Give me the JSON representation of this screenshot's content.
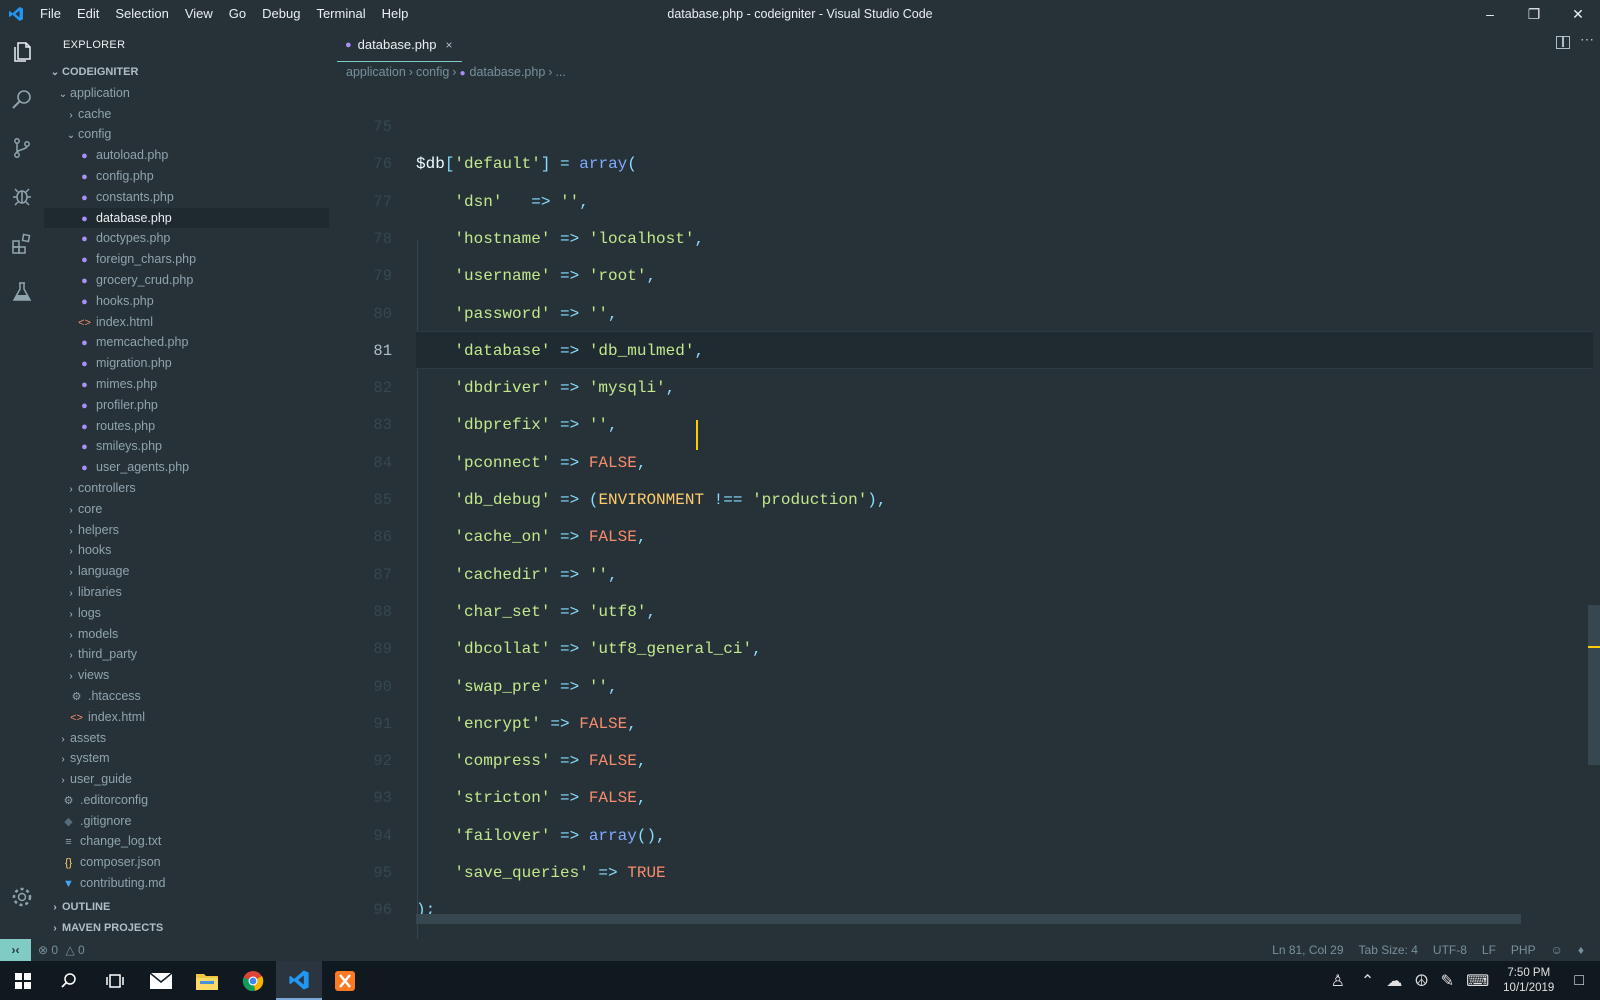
{
  "window": {
    "title": "database.php - codeigniter - Visual Studio Code",
    "menu": [
      "File",
      "Edit",
      "Selection",
      "View",
      "Go",
      "Debug",
      "Terminal",
      "Help"
    ]
  },
  "explorer": {
    "title": "EXPLORER",
    "project": "CODEIGNITER",
    "outline": "OUTLINE",
    "maven": "MAVEN PROJECTS",
    "items": [
      {
        "label": "application",
        "depth": 1,
        "chevron": "v",
        "icon": ""
      },
      {
        "label": "cache",
        "depth": 2,
        "chevron": ">",
        "icon": ""
      },
      {
        "label": "config",
        "depth": 2,
        "chevron": "v",
        "icon": ""
      },
      {
        "label": "autoload.php",
        "depth": 3,
        "chevron": "",
        "icon": "php"
      },
      {
        "label": "config.php",
        "depth": 3,
        "chevron": "",
        "icon": "php"
      },
      {
        "label": "constants.php",
        "depth": 3,
        "chevron": "",
        "icon": "php"
      },
      {
        "label": "database.php",
        "depth": 3,
        "chevron": "",
        "icon": "php",
        "selected": true
      },
      {
        "label": "doctypes.php",
        "depth": 3,
        "chevron": "",
        "icon": "php"
      },
      {
        "label": "foreign_chars.php",
        "depth": 3,
        "chevron": "",
        "icon": "php"
      },
      {
        "label": "grocery_crud.php",
        "depth": 3,
        "chevron": "",
        "icon": "php"
      },
      {
        "label": "hooks.php",
        "depth": 3,
        "chevron": "",
        "icon": "php"
      },
      {
        "label": "index.html",
        "depth": 3,
        "chevron": "",
        "icon": "html"
      },
      {
        "label": "memcached.php",
        "depth": 3,
        "chevron": "",
        "icon": "php"
      },
      {
        "label": "migration.php",
        "depth": 3,
        "chevron": "",
        "icon": "php"
      },
      {
        "label": "mimes.php",
        "depth": 3,
        "chevron": "",
        "icon": "php"
      },
      {
        "label": "profiler.php",
        "depth": 3,
        "chevron": "",
        "icon": "php"
      },
      {
        "label": "routes.php",
        "depth": 3,
        "chevron": "",
        "icon": "php"
      },
      {
        "label": "smileys.php",
        "depth": 3,
        "chevron": "",
        "icon": "php"
      },
      {
        "label": "user_agents.php",
        "depth": 3,
        "chevron": "",
        "icon": "php"
      },
      {
        "label": "controllers",
        "depth": 2,
        "chevron": ">",
        "icon": ""
      },
      {
        "label": "core",
        "depth": 2,
        "chevron": ">",
        "icon": ""
      },
      {
        "label": "helpers",
        "depth": 2,
        "chevron": ">",
        "icon": ""
      },
      {
        "label": "hooks",
        "depth": 2,
        "chevron": ">",
        "icon": ""
      },
      {
        "label": "language",
        "depth": 2,
        "chevron": ">",
        "icon": ""
      },
      {
        "label": "libraries",
        "depth": 2,
        "chevron": ">",
        "icon": ""
      },
      {
        "label": "logs",
        "depth": 2,
        "chevron": ">",
        "icon": ""
      },
      {
        "label": "models",
        "depth": 2,
        "chevron": ">",
        "icon": ""
      },
      {
        "label": "third_party",
        "depth": 2,
        "chevron": ">",
        "icon": ""
      },
      {
        "label": "views",
        "depth": 2,
        "chevron": ">",
        "icon": ""
      },
      {
        "label": ".htaccess",
        "depth": 2,
        "chevron": "",
        "icon": "gear"
      },
      {
        "label": "index.html",
        "depth": 2,
        "chevron": "",
        "icon": "html"
      },
      {
        "label": "assets",
        "depth": 1,
        "chevron": ">",
        "icon": ""
      },
      {
        "label": "system",
        "depth": 1,
        "chevron": ">",
        "icon": ""
      },
      {
        "label": "user_guide",
        "depth": 1,
        "chevron": ">",
        "icon": ""
      },
      {
        "label": ".editorconfig",
        "depth": 1,
        "chevron": "",
        "icon": "gear"
      },
      {
        "label": ".gitignore",
        "depth": 1,
        "chevron": "",
        "icon": "git"
      },
      {
        "label": "change_log.txt",
        "depth": 1,
        "chevron": "",
        "icon": "txt"
      },
      {
        "label": "composer.json",
        "depth": 1,
        "chevron": "",
        "icon": "json"
      },
      {
        "label": "contributing.md",
        "depth": 1,
        "chevron": "",
        "icon": "md"
      }
    ]
  },
  "tab": {
    "label": "database.php",
    "close": "×"
  },
  "breadcrumb": [
    "application",
    "config",
    "database.php",
    "..."
  ],
  "code": {
    "current_line": 81,
    "lines": [
      {
        "n": "75",
        "tokens": []
      },
      {
        "n": "76",
        "tokens": [
          [
            "v",
            "$db"
          ],
          [
            "p",
            "["
          ],
          [
            "s",
            "'default'"
          ],
          [
            "p",
            "]"
          ],
          [
            "o",
            " = "
          ],
          [
            "f",
            "array"
          ],
          [
            "p",
            "("
          ]
        ]
      },
      {
        "n": "77",
        "tokens": [
          [
            "s",
            "    'dsn'"
          ],
          [
            "o",
            "   => "
          ],
          [
            "s",
            "''"
          ],
          [
            "p",
            ","
          ]
        ]
      },
      {
        "n": "78",
        "tokens": [
          [
            "s",
            "    'hostname'"
          ],
          [
            "o",
            " => "
          ],
          [
            "s",
            "'localhost'"
          ],
          [
            "p",
            ","
          ]
        ]
      },
      {
        "n": "79",
        "tokens": [
          [
            "s",
            "    'username'"
          ],
          [
            "o",
            " => "
          ],
          [
            "s",
            "'root'"
          ],
          [
            "p",
            ","
          ]
        ]
      },
      {
        "n": "80",
        "tokens": [
          [
            "s",
            "    'password'"
          ],
          [
            "o",
            " => "
          ],
          [
            "s",
            "''"
          ],
          [
            "p",
            ","
          ]
        ]
      },
      {
        "n": "81",
        "tokens": [
          [
            "s",
            "    'database'"
          ],
          [
            "o",
            " => "
          ],
          [
            "s",
            "'db_mulmed'"
          ],
          [
            "p",
            ","
          ]
        ]
      },
      {
        "n": "82",
        "tokens": [
          [
            "s",
            "    'dbdriver'"
          ],
          [
            "o",
            " => "
          ],
          [
            "s",
            "'mysqli'"
          ],
          [
            "p",
            ","
          ]
        ]
      },
      {
        "n": "83",
        "tokens": [
          [
            "s",
            "    'dbprefix'"
          ],
          [
            "o",
            " => "
          ],
          [
            "s",
            "''"
          ],
          [
            "p",
            ","
          ]
        ]
      },
      {
        "n": "84",
        "tokens": [
          [
            "s",
            "    'pconnect'"
          ],
          [
            "o",
            " => "
          ],
          [
            "k",
            "FALSE"
          ],
          [
            "p",
            ","
          ]
        ]
      },
      {
        "n": "85",
        "tokens": [
          [
            "s",
            "    'db_debug'"
          ],
          [
            "o",
            " => "
          ],
          [
            "p",
            "("
          ],
          [
            "c",
            "ENVIRONMENT"
          ],
          [
            "o",
            " !== "
          ],
          [
            "s",
            "'production'"
          ],
          [
            "p",
            "),"
          ]
        ]
      },
      {
        "n": "86",
        "tokens": [
          [
            "s",
            "    'cache_on'"
          ],
          [
            "o",
            " => "
          ],
          [
            "k",
            "FALSE"
          ],
          [
            "p",
            ","
          ]
        ]
      },
      {
        "n": "87",
        "tokens": [
          [
            "s",
            "    'cachedir'"
          ],
          [
            "o",
            " => "
          ],
          [
            "s",
            "''"
          ],
          [
            "p",
            ","
          ]
        ]
      },
      {
        "n": "88",
        "tokens": [
          [
            "s",
            "    'char_set'"
          ],
          [
            "o",
            " => "
          ],
          [
            "s",
            "'utf8'"
          ],
          [
            "p",
            ","
          ]
        ]
      },
      {
        "n": "89",
        "tokens": [
          [
            "s",
            "    'dbcollat'"
          ],
          [
            "o",
            " => "
          ],
          [
            "s",
            "'utf8_general_ci'"
          ],
          [
            "p",
            ","
          ]
        ]
      },
      {
        "n": "90",
        "tokens": [
          [
            "s",
            "    'swap_pre'"
          ],
          [
            "o",
            " => "
          ],
          [
            "s",
            "''"
          ],
          [
            "p",
            ","
          ]
        ]
      },
      {
        "n": "91",
        "tokens": [
          [
            "s",
            "    'encrypt'"
          ],
          [
            "o",
            " => "
          ],
          [
            "k",
            "FALSE"
          ],
          [
            "p",
            ","
          ]
        ]
      },
      {
        "n": "92",
        "tokens": [
          [
            "s",
            "    'compress'"
          ],
          [
            "o",
            " => "
          ],
          [
            "k",
            "FALSE"
          ],
          [
            "p",
            ","
          ]
        ]
      },
      {
        "n": "93",
        "tokens": [
          [
            "s",
            "    'stricton'"
          ],
          [
            "o",
            " => "
          ],
          [
            "k",
            "FALSE"
          ],
          [
            "p",
            ","
          ]
        ]
      },
      {
        "n": "94",
        "tokens": [
          [
            "s",
            "    'failover'"
          ],
          [
            "o",
            " => "
          ],
          [
            "f",
            "array"
          ],
          [
            "p",
            "(),"
          ]
        ]
      },
      {
        "n": "95",
        "tokens": [
          [
            "s",
            "    'save_queries'"
          ],
          [
            "o",
            " => "
          ],
          [
            "k",
            "TRUE"
          ]
        ]
      },
      {
        "n": "96",
        "tokens": [
          [
            "p",
            ");"
          ]
        ]
      }
    ]
  },
  "status": {
    "errors": "0",
    "warnings": "0",
    "position": "Ln 81, Col 29",
    "tab_size": "Tab Size: 4",
    "encoding": "UTF-8",
    "eol": "LF",
    "language": "PHP"
  },
  "taskbar": {
    "time": "7:50 PM",
    "date": "10/1/2019"
  },
  "colors": {
    "background": "#263238",
    "accent": "#80cbc4",
    "caret": "#ffcc00"
  }
}
